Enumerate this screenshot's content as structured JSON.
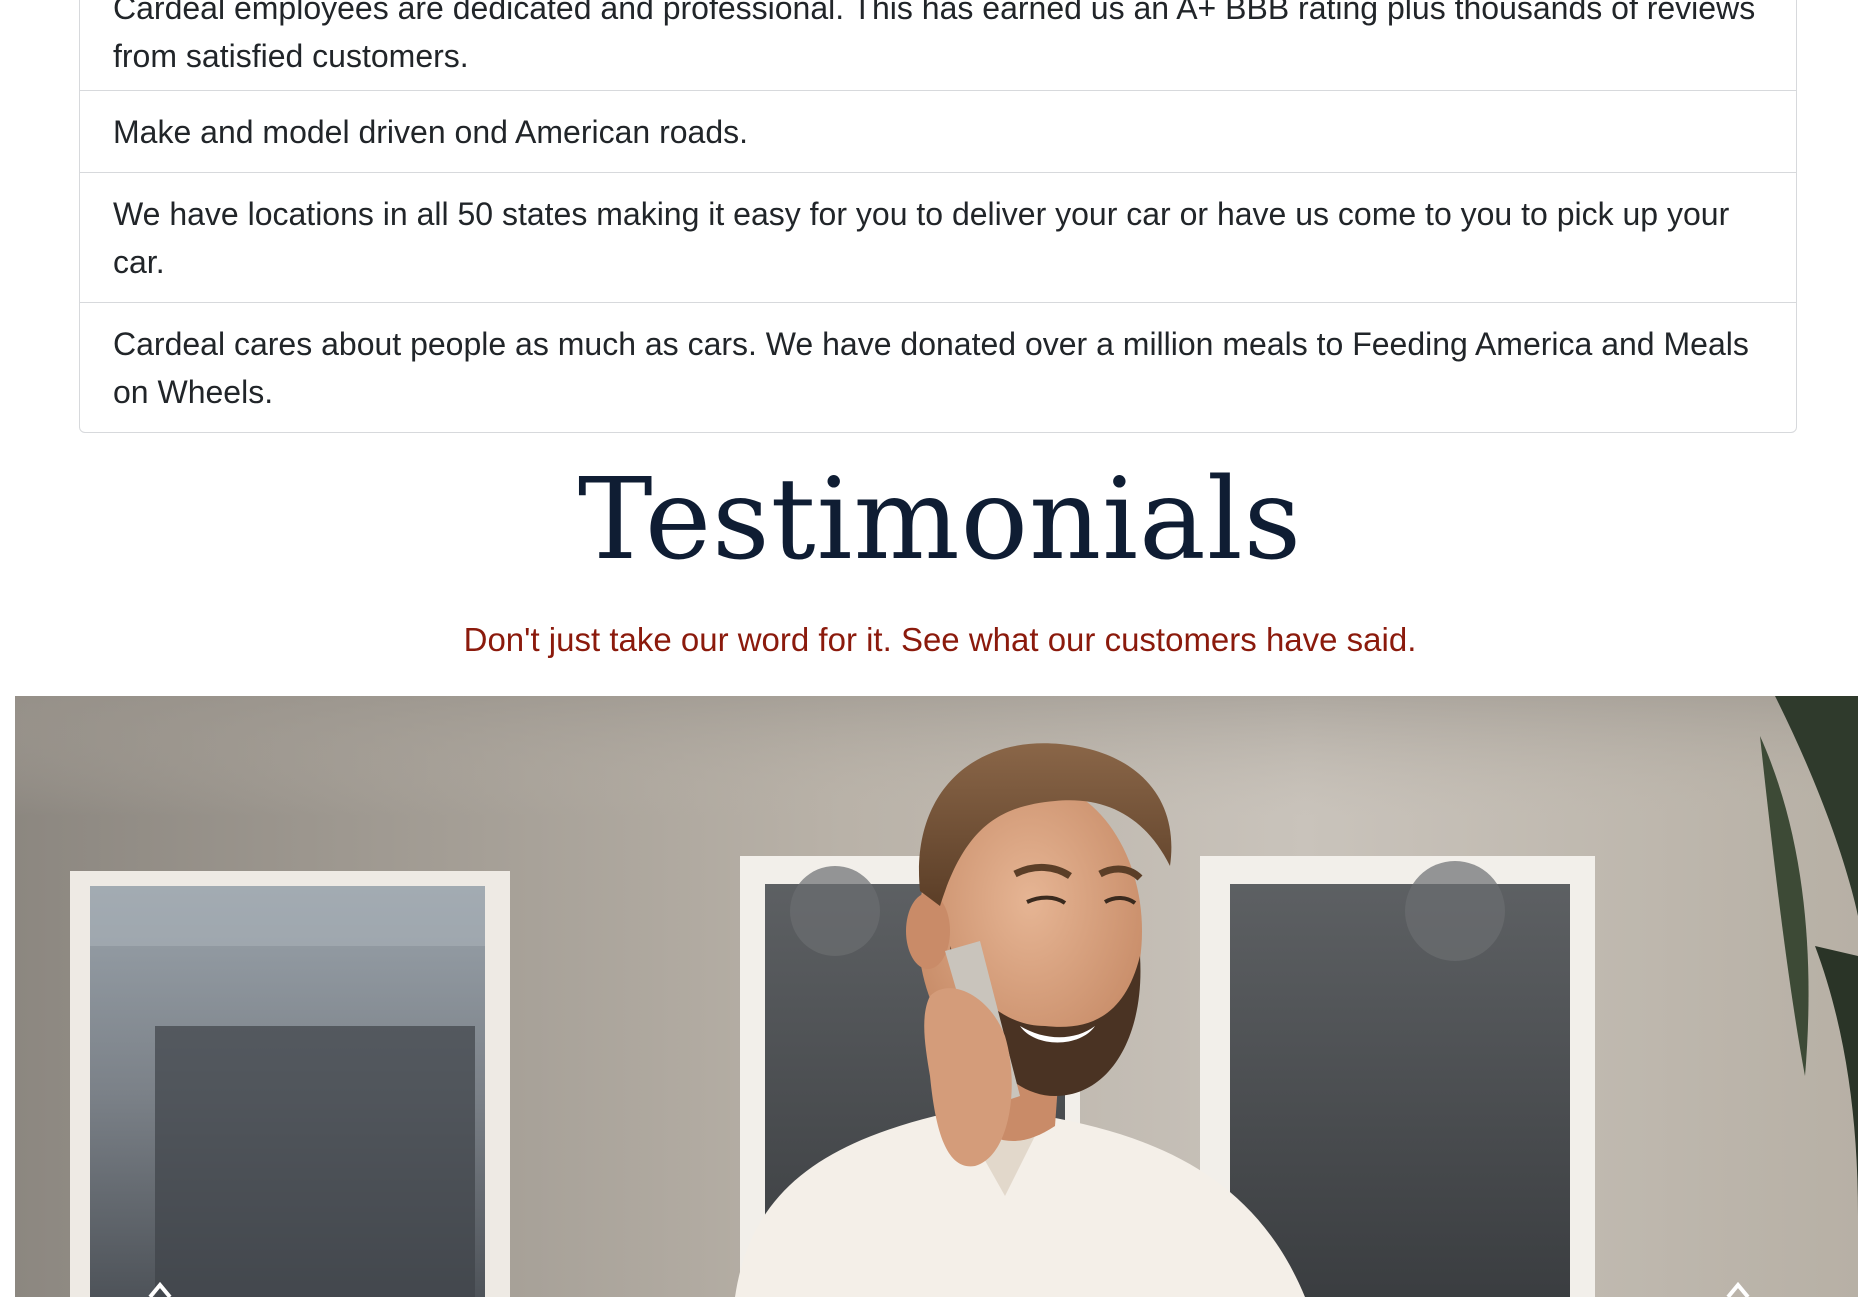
{
  "features": [
    "Cardeal employees are dedicated and professional. This has earned us an A+ BBB rating plus thousands of reviews from satisfied customers.",
    "Make and model driven ond American roads.",
    "We have locations in all 50 states making it easy for you to deliver your car or have us come to you to pick up your car.",
    "Cardeal cares about people as much as cars. We have donated over a million meals to Feeding America and Meals on Wheels."
  ],
  "testimonials": {
    "title": "Testimonials",
    "subtitle": "Don't just take our word for it. See what our customers have said."
  },
  "carousel": {
    "prev_icon": "chevron-left-icon",
    "next_icon": "chevron-right-icon"
  },
  "colors": {
    "title": "#0f1d33",
    "subtitle": "#8b1a0c",
    "border": "#d7d9dc"
  }
}
